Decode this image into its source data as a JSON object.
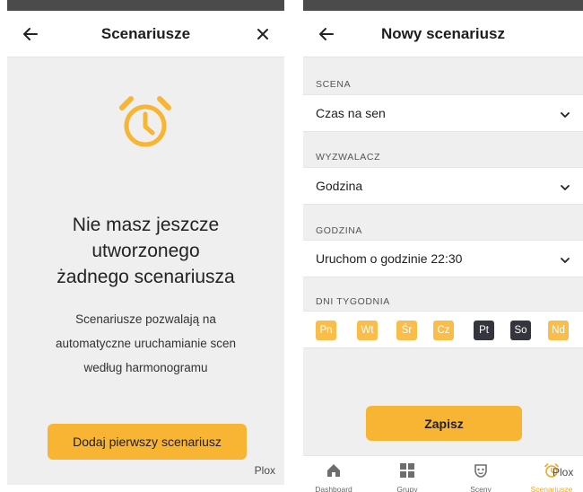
{
  "left_screen": {
    "title": "Scenariusze",
    "empty_title": "Nie masz jeszcze\nutworzonego\nżadnego scenariusza",
    "empty_description": "Scenariusze pozwalają na\nautomatyczne uruchamianie scen\nwedług harmonogramu",
    "add_button_label": "Dodaj pierwszy scenariusz",
    "brand": "Plox",
    "icons": {
      "back": "arrow-left-icon",
      "close": "close-icon",
      "empty": "alarm-clock-icon"
    }
  },
  "right_screen": {
    "title": "Nowy scenariusz",
    "sections": [
      {
        "label": "SCENA",
        "value": "Czas na sen"
      },
      {
        "label": "WYZWALACZ",
        "value": "Godzina"
      },
      {
        "label": "GODZINA",
        "value": "Uruchom o godzinie 22:30"
      }
    ],
    "days_label": "DNI TYGODNIA",
    "days": [
      {
        "label": "Pn",
        "selected": false
      },
      {
        "label": "Wt",
        "selected": false
      },
      {
        "label": "Śr",
        "selected": false
      },
      {
        "label": "Cz",
        "selected": false
      },
      {
        "label": "Pt",
        "selected": true
      },
      {
        "label": "So",
        "selected": true
      },
      {
        "label": "Nd",
        "selected": false
      }
    ],
    "save_button_label": "Zapisz",
    "brand": "Plox",
    "bottom_nav": [
      {
        "label": "Dashboard",
        "icon": "home-icon",
        "active": false
      },
      {
        "label": "Grupy",
        "icon": "grid-icon",
        "active": false
      },
      {
        "label": "Sceny",
        "icon": "mask-icon",
        "active": false
      },
      {
        "label": "Scenariusze",
        "icon": "alarm-clock-icon",
        "active": true
      }
    ]
  },
  "colors": {
    "accent": "#f8b534",
    "day_unselected": "#fbbd4a",
    "day_selected": "#34353d",
    "background": "#efefef",
    "status_bar": "#4b4b4b"
  }
}
